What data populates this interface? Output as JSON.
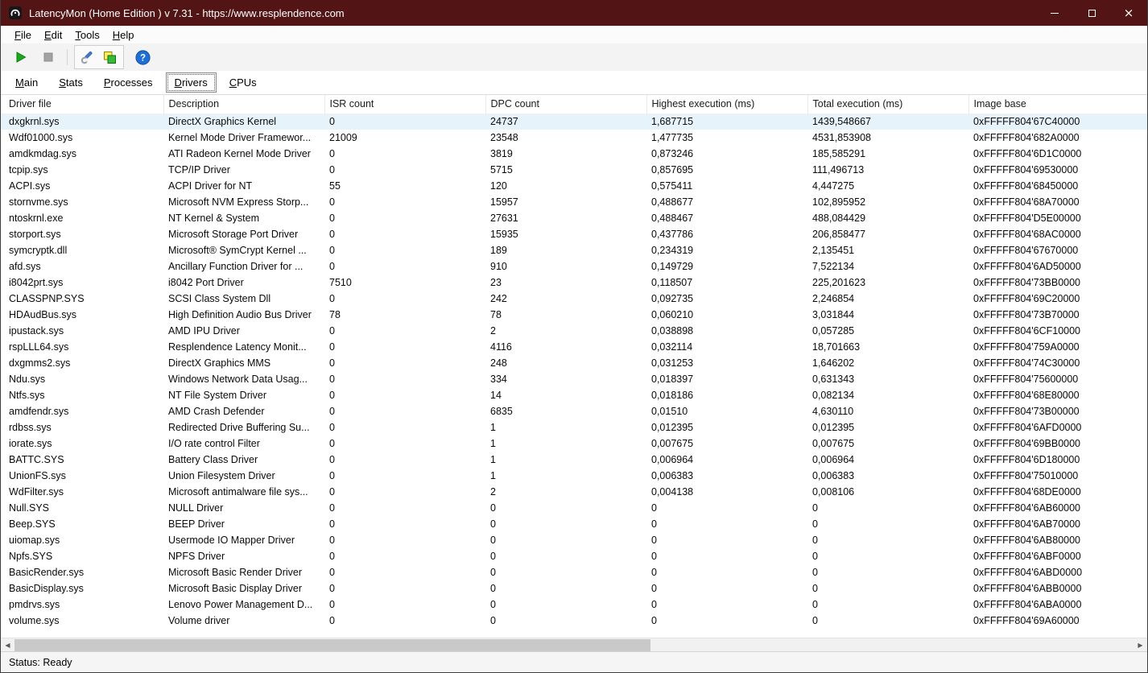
{
  "window": {
    "title": "LatencyMon  (Home Edition )  v 7.31 - https://www.resplendence.com",
    "close_glyph": "×"
  },
  "menu": {
    "items": [
      "File",
      "Edit",
      "Tools",
      "Help"
    ]
  },
  "toolbar": {
    "buttons": [
      "start-monitor",
      "stop-monitor",
      "options",
      "report",
      "help"
    ]
  },
  "tabs": [
    "Main",
    "Stats",
    "Processes",
    "Drivers",
    "CPUs"
  ],
  "active_tab": "Drivers",
  "table": {
    "columns": [
      "Driver file",
      "Description",
      "ISR count",
      "DPC count",
      "Highest execution (ms)",
      "Total execution (ms)",
      "Image base"
    ],
    "selected_row": 0,
    "rows": [
      [
        "dxgkrnl.sys",
        "DirectX Graphics Kernel",
        "0",
        "24737",
        "1,687715",
        "1439,548667",
        "0xFFFFF804'67C40000"
      ],
      [
        "Wdf01000.sys",
        "Kernel Mode Driver Framewor...",
        "21009",
        "23548",
        "1,477735",
        "4531,853908",
        "0xFFFFF804'682A0000"
      ],
      [
        "amdkmdag.sys",
        "ATI Radeon Kernel Mode Driver",
        "0",
        "3819",
        "0,873246",
        "185,585291",
        "0xFFFFF804'6D1C0000"
      ],
      [
        "tcpip.sys",
        "TCP/IP Driver",
        "0",
        "5715",
        "0,857695",
        "111,496713",
        "0xFFFFF804'69530000"
      ],
      [
        "ACPI.sys",
        "ACPI Driver for NT",
        "55",
        "120",
        "0,575411",
        "4,447275",
        "0xFFFFF804'68450000"
      ],
      [
        "stornvme.sys",
        "Microsoft NVM Express Storp...",
        "0",
        "15957",
        "0,488677",
        "102,895952",
        "0xFFFFF804'68A70000"
      ],
      [
        "ntoskrnl.exe",
        "NT Kernel & System",
        "0",
        "27631",
        "0,488467",
        "488,084429",
        "0xFFFFF804'D5E00000"
      ],
      [
        "storport.sys",
        "Microsoft Storage Port Driver",
        "0",
        "15935",
        "0,437786",
        "206,858477",
        "0xFFFFF804'68AC0000"
      ],
      [
        "symcryptk.dll",
        "Microsoft® SymCrypt Kernel ...",
        "0",
        "189",
        "0,234319",
        "2,135451",
        "0xFFFFF804'67670000"
      ],
      [
        "afd.sys",
        "Ancillary Function Driver for ...",
        "0",
        "910",
        "0,149729",
        "7,522134",
        "0xFFFFF804'6AD50000"
      ],
      [
        "i8042prt.sys",
        "i8042 Port Driver",
        "7510",
        "23",
        "0,118507",
        "225,201623",
        "0xFFFFF804'73BB0000"
      ],
      [
        "CLASSPNP.SYS",
        "SCSI Class System Dll",
        "0",
        "242",
        "0,092735",
        "2,246854",
        "0xFFFFF804'69C20000"
      ],
      [
        "HDAudBus.sys",
        "High Definition Audio Bus Driver",
        "78",
        "78",
        "0,060210",
        "3,031844",
        "0xFFFFF804'73B70000"
      ],
      [
        "ipustack.sys",
        "AMD IPU Driver",
        "0",
        "2",
        "0,038898",
        "0,057285",
        "0xFFFFF804'6CF10000"
      ],
      [
        "rspLLL64.sys",
        "Resplendence Latency Monit...",
        "0",
        "4116",
        "0,032114",
        "18,701663",
        "0xFFFFF804'759A0000"
      ],
      [
        "dxgmms2.sys",
        "DirectX Graphics MMS",
        "0",
        "248",
        "0,031253",
        "1,646202",
        "0xFFFFF804'74C30000"
      ],
      [
        "Ndu.sys",
        "Windows Network Data Usag...",
        "0",
        "334",
        "0,018397",
        "0,631343",
        "0xFFFFF804'75600000"
      ],
      [
        "Ntfs.sys",
        "NT File System Driver",
        "0",
        "14",
        "0,018186",
        "0,082134",
        "0xFFFFF804'68E80000"
      ],
      [
        "amdfendr.sys",
        "AMD Crash Defender",
        "0",
        "6835",
        "0,01510",
        "4,630110",
        "0xFFFFF804'73B00000"
      ],
      [
        "rdbss.sys",
        "Redirected Drive Buffering Su...",
        "0",
        "1",
        "0,012395",
        "0,012395",
        "0xFFFFF804'6AFD0000"
      ],
      [
        "iorate.sys",
        "I/O rate control Filter",
        "0",
        "1",
        "0,007675",
        "0,007675",
        "0xFFFFF804'69BB0000"
      ],
      [
        "BATTC.SYS",
        "Battery Class Driver",
        "0",
        "1",
        "0,006964",
        "0,006964",
        "0xFFFFF804'6D180000"
      ],
      [
        "UnionFS.sys",
        "Union Filesystem Driver",
        "0",
        "1",
        "0,006383",
        "0,006383",
        "0xFFFFF804'75010000"
      ],
      [
        "WdFilter.sys",
        "Microsoft antimalware file sys...",
        "0",
        "2",
        "0,004138",
        "0,008106",
        "0xFFFFF804'68DE0000"
      ],
      [
        "Null.SYS",
        "NULL Driver",
        "0",
        "0",
        "0",
        "0",
        "0xFFFFF804'6AB60000"
      ],
      [
        "Beep.SYS",
        "BEEP Driver",
        "0",
        "0",
        "0",
        "0",
        "0xFFFFF804'6AB70000"
      ],
      [
        "uiomap.sys",
        "Usermode IO Mapper Driver",
        "0",
        "0",
        "0",
        "0",
        "0xFFFFF804'6AB80000"
      ],
      [
        "Npfs.SYS",
        "NPFS Driver",
        "0",
        "0",
        "0",
        "0",
        "0xFFFFF804'6ABF0000"
      ],
      [
        "BasicRender.sys",
        "Microsoft Basic Render Driver",
        "0",
        "0",
        "0",
        "0",
        "0xFFFFF804'6ABD0000"
      ],
      [
        "BasicDisplay.sys",
        "Microsoft Basic Display Driver",
        "0",
        "0",
        "0",
        "0",
        "0xFFFFF804'6ABB0000"
      ],
      [
        "pmdrvs.sys",
        "Lenovo Power Management D...",
        "0",
        "0",
        "0",
        "0",
        "0xFFFFF804'6ABA0000"
      ],
      [
        "volume.sys",
        "Volume driver",
        "0",
        "0",
        "0",
        "0",
        "0xFFFFF804'69A60000"
      ]
    ]
  },
  "statusbar": {
    "text": "Status: Ready"
  }
}
